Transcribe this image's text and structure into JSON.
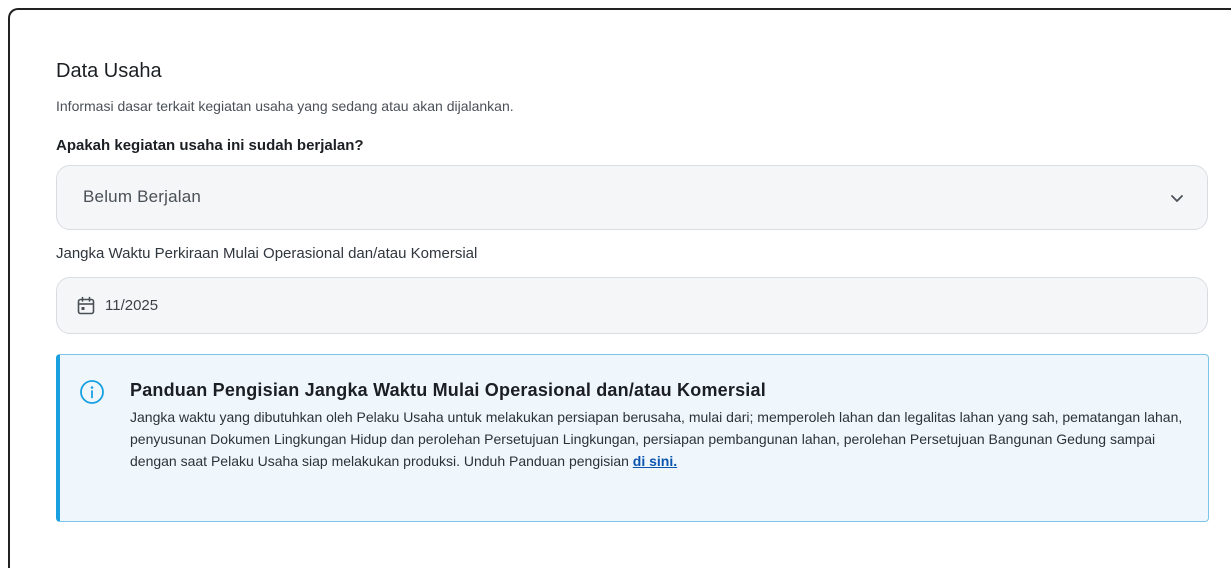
{
  "section": {
    "title": "Data Usaha",
    "subtitle": "Informasi dasar terkait kegiatan usaha yang sedang atau akan dijalankan."
  },
  "status_question": {
    "label": "Apakah kegiatan usaha ini sudah berjalan?",
    "selected_value": "Belum Berjalan",
    "icon": "chevron-down-icon"
  },
  "start_period": {
    "label": "Jangka Waktu Perkiraan Mulai Operasional dan/atau Komersial",
    "value": "11/2025",
    "icon": "calendar-icon"
  },
  "guide": {
    "icon": "info-icon",
    "title": "Panduan Pengisian Jangka Waktu Mulai Operasional dan/atau Komersial",
    "body": "Jangka waktu yang dibutuhkan oleh Pelaku Usaha untuk melakukan persiapan berusaha, mulai dari; memperoleh lahan dan legalitas lahan yang sah, pematangan lahan, penyusunan Dokumen Lingkungan Hidup dan perolehan Persetujuan Lingkungan, persiapan pembangunan lahan, perolehan Persetujuan Bangunan Gedung sampai dengan saat Pelaku Usaha siap melakukan produksi. Unduh Panduan pengisian",
    "link_text": "di sini.",
    "accent_color": "#18a0e0",
    "link_color": "#0b55b0"
  }
}
